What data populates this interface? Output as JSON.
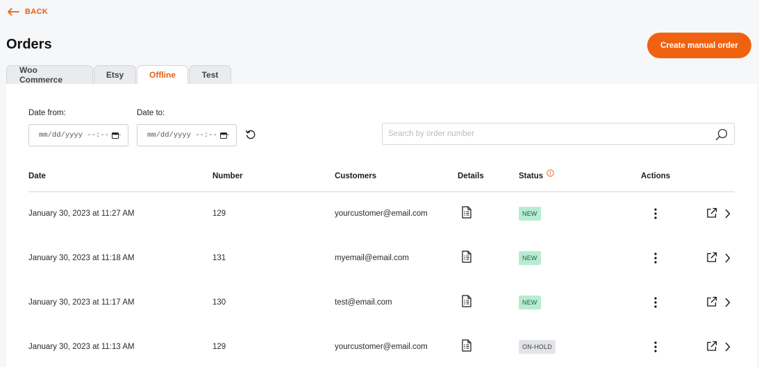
{
  "nav": {
    "back_label": "BACK"
  },
  "header": {
    "title": "Orders",
    "create_button": "Create manual order"
  },
  "tabs": [
    {
      "label": "Woo Commerce",
      "active": false
    },
    {
      "label": "Etsy",
      "active": false
    },
    {
      "label": "Offline",
      "active": true
    },
    {
      "label": "Test",
      "active": false
    }
  ],
  "filters": {
    "date_from_label": "Date from:",
    "date_to_label": "Date to:",
    "date_from_value": "mm/dd/yyyy --:-- --",
    "date_to_value": "mm/dd/yyyy --:-- --",
    "search_placeholder": "Search by order number"
  },
  "table": {
    "columns": [
      "Date",
      "Number",
      "Customers",
      "Details",
      "Status",
      "Actions"
    ],
    "rows": [
      {
        "date": "January 30, 2023 at 11:27 AM",
        "number": "129",
        "customer": "yourcustomer@email.com",
        "status": "NEW"
      },
      {
        "date": "January 30, 2023 at 11:18 AM",
        "number": "131",
        "customer": "myemail@email.com",
        "status": "NEW"
      },
      {
        "date": "January 30, 2023 at 11:17 AM",
        "number": "130",
        "customer": "test@email.com",
        "status": "NEW"
      },
      {
        "date": "January 30, 2023 at 11:13 AM",
        "number": "129",
        "customer": "yourcustomer@email.com",
        "status": "ON-HOLD"
      }
    ]
  },
  "icons": {
    "back": "arrow-left-icon",
    "reset": "refresh-icon",
    "search": "search-icon",
    "status_info": "info-icon",
    "details": "document-icon",
    "actions": [
      "more-vertical-icon",
      "external-link-icon",
      "chevron-right-icon"
    ]
  },
  "colors": {
    "accent": "#f0620f",
    "badge_new_bg": "#b8ecd2",
    "badge_hold_bg": "#e2e4e7"
  }
}
